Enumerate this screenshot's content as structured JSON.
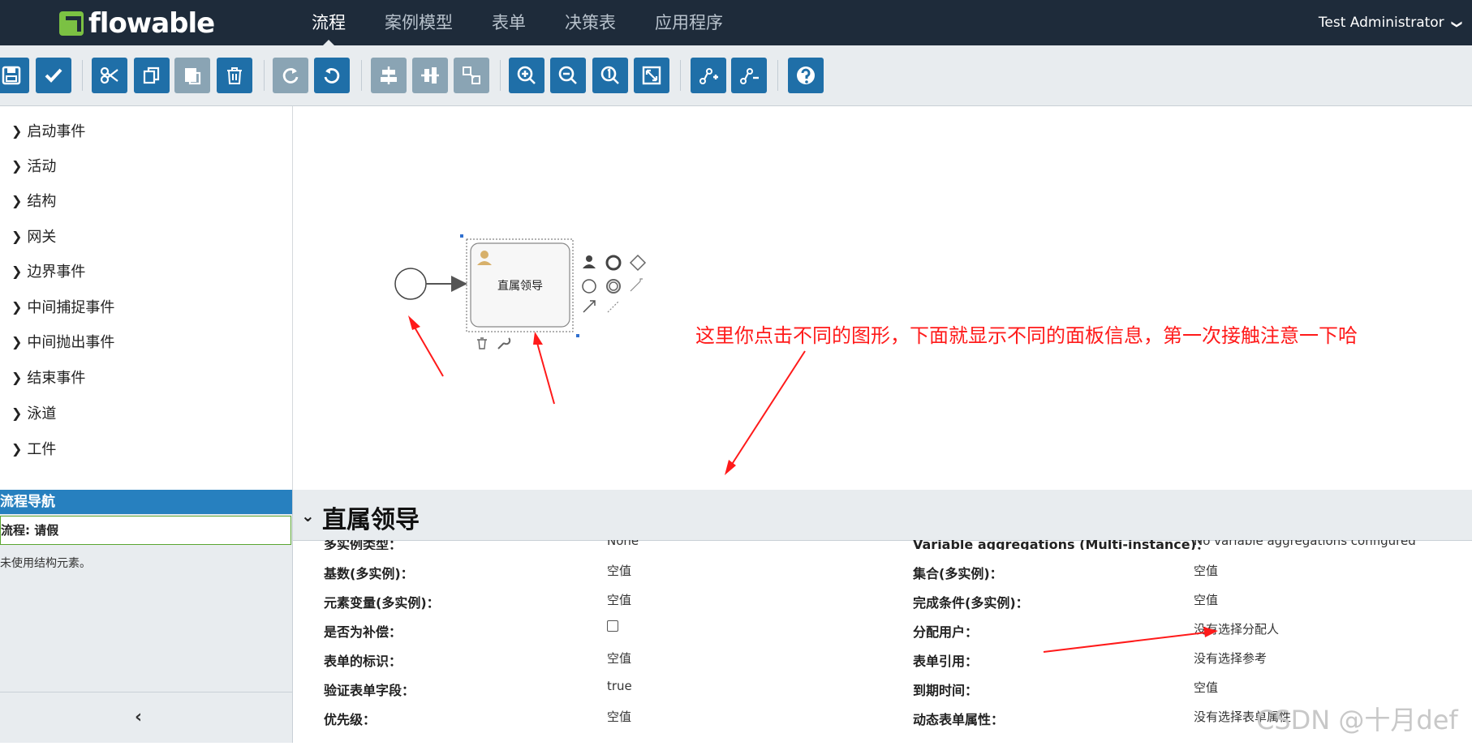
{
  "header": {
    "logo": "flowable",
    "nav": [
      "流程",
      "案例模型",
      "表单",
      "决策表",
      "应用程序"
    ],
    "active_nav": "流程",
    "user": "Test Administrator",
    "user_caret": "❯"
  },
  "toolbar": {
    "buttons": [
      {
        "icon": "save-icon",
        "enabled": true
      },
      {
        "icon": "validate-check-icon",
        "enabled": true
      },
      {
        "icon": "cut-icon",
        "enabled": true
      },
      {
        "icon": "copy-icon",
        "enabled": true
      },
      {
        "icon": "paste-icon",
        "enabled": false
      },
      {
        "icon": "delete-icon",
        "enabled": true
      },
      {
        "icon": "redo-icon",
        "enabled": false
      },
      {
        "icon": "undo-icon",
        "enabled": true
      },
      {
        "icon": "align-horizontal-icon",
        "enabled": false
      },
      {
        "icon": "align-vertical-icon",
        "enabled": false
      },
      {
        "icon": "same-size-icon",
        "enabled": false
      },
      {
        "icon": "zoom-in-icon",
        "enabled": true
      },
      {
        "icon": "zoom-out-icon",
        "enabled": true
      },
      {
        "icon": "zoom-actual-icon",
        "enabled": true
      },
      {
        "icon": "zoom-fit-icon",
        "enabled": true
      },
      {
        "icon": "add-bendpoint-icon",
        "enabled": true
      },
      {
        "icon": "remove-bendpoint-icon",
        "enabled": true
      },
      {
        "icon": "help-icon",
        "enabled": true
      }
    ]
  },
  "palette": {
    "chevron": "❯",
    "items": [
      "启动事件",
      "活动",
      "结构",
      "网关",
      "边界事件",
      "中间捕捉事件",
      "中间抛出事件",
      "结束事件",
      "泳道",
      "工件"
    ]
  },
  "navigator": {
    "title": "流程导航",
    "process": "流程: 请假",
    "note": "未使用结构元素。",
    "collapse": "‹"
  },
  "canvas": {
    "task_name": "直属领导",
    "annotation": "这里你点击不同的图形，下面就显示不同的面板信息，第一次接触注意一下哈"
  },
  "properties": {
    "title": "直属领导",
    "chevron": "⌄",
    "top_cut_left": {
      "label": "多实例类型：",
      "value": "None"
    },
    "top_cut_right": {
      "label": "Variable aggregations (Multi-instance)：",
      "value": "No variable aggregations configured"
    },
    "left": [
      {
        "label": "基数(多实例)：",
        "value": "空值"
      },
      {
        "label": "元素变量(多实例)：",
        "value": "空值"
      },
      {
        "label": "是否为补偿：",
        "value": ""
      },
      {
        "label": "表单的标识：",
        "value": "空值"
      },
      {
        "label": "验证表单字段：",
        "value": "true"
      },
      {
        "label": "优先级：",
        "value": "空值"
      }
    ],
    "right": [
      {
        "label": "集合(多实例)：",
        "value": "空值"
      },
      {
        "label": "完成条件(多实例)：",
        "value": "空值"
      },
      {
        "label": "分配用户：",
        "value": "没有选择分配人"
      },
      {
        "label": "表单引用：",
        "value": "没有选择参考"
      },
      {
        "label": "到期时间：",
        "value": "空值"
      },
      {
        "label": "动态表单属性：",
        "value": "没有选择表单属性"
      }
    ]
  },
  "watermark": "CSDN @十月def",
  "colors": {
    "topbar": "#1e2b3a",
    "toolbar_button": "#1f6fa8",
    "toolbar_button_disabled": "#8aa4b4",
    "annotation": "#ff1a1a",
    "navigator_header": "#2780bf"
  }
}
